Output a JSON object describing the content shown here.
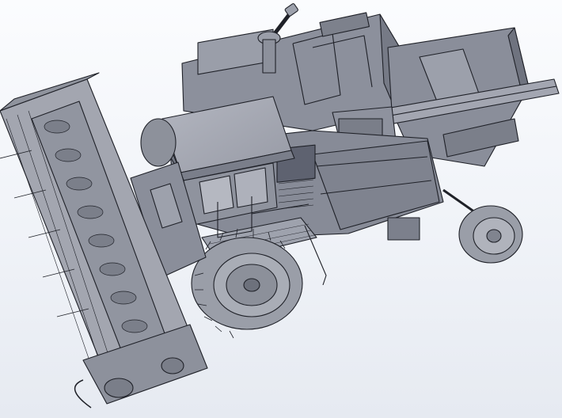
{
  "scene": {
    "subject": "combine-harvester-cad-model",
    "view": "isometric",
    "render_style": "shaded-with-edges"
  },
  "colors": {
    "background_top": "#fbfcfe",
    "background_bottom": "#e6eaf1",
    "body_grey": "#8e93a0",
    "body_light": "#a9adb8",
    "body_dark": "#6c707c",
    "edge": "#1f2128",
    "tire": "#9a9ea8",
    "tire_dark": "#6f737d"
  }
}
